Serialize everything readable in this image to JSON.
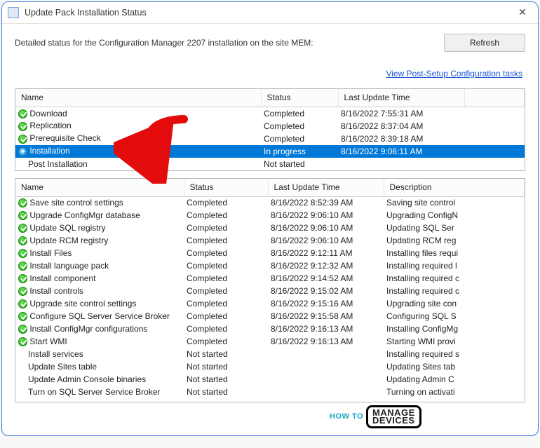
{
  "window": {
    "title": "Update Pack Installation Status",
    "close_glyph": "✕"
  },
  "header": {
    "subtitle": "Detailed status for the Configuration Manager 2207 installation on the site MEM:",
    "refresh_label": "Refresh",
    "link_label": "View Post-Setup Configuration tasks"
  },
  "table1": {
    "columns": {
      "name": "Name",
      "status": "Status",
      "time": "Last Update Time"
    },
    "rows": [
      {
        "icon": "completed",
        "name": "Download",
        "status": "Completed",
        "time": "8/16/2022 7:55:31 AM",
        "selected": false
      },
      {
        "icon": "completed",
        "name": "Replication",
        "status": "Completed",
        "time": "8/16/2022 8:37:04 AM",
        "selected": false
      },
      {
        "icon": "completed",
        "name": "Prerequisite Check",
        "status": "Completed",
        "time": "8/16/2022 8:39:18 AM",
        "selected": false
      },
      {
        "icon": "inprogress",
        "name": "Installation",
        "status": "In progress",
        "time": "8/16/2022 9:06:11 AM",
        "selected": true
      },
      {
        "icon": "",
        "name": "Post Installation",
        "status": "Not started",
        "time": "",
        "selected": false,
        "indent": 1
      }
    ]
  },
  "table2": {
    "columns": {
      "name": "Name",
      "status": "Status",
      "time": "Last Update Time",
      "desc": "Description"
    },
    "rows": [
      {
        "icon": "completed",
        "name": "Save site control settings",
        "status": "Completed",
        "time": "8/16/2022 8:52:39 AM",
        "desc": "Saving site control"
      },
      {
        "icon": "completed",
        "name": "Upgrade ConfigMgr database",
        "status": "Completed",
        "time": "8/16/2022 9:06:10 AM",
        "desc": "Upgrading ConfigN"
      },
      {
        "icon": "completed",
        "name": "Update SQL registry",
        "status": "Completed",
        "time": "8/16/2022 9:06:10 AM",
        "desc": "Updating SQL Ser"
      },
      {
        "icon": "completed",
        "name": "Update RCM registry",
        "status": "Completed",
        "time": "8/16/2022 9:06:10 AM",
        "desc": "Updating RCM reg"
      },
      {
        "icon": "completed",
        "name": "Install Files",
        "status": "Completed",
        "time": "8/16/2022 9:12:11 AM",
        "desc": "Installing files requi"
      },
      {
        "icon": "completed",
        "name": "Install language pack",
        "status": "Completed",
        "time": "8/16/2022 9:12:32 AM",
        "desc": "Installing required l"
      },
      {
        "icon": "completed",
        "name": "Install component",
        "status": "Completed",
        "time": "8/16/2022 9:14:52 AM",
        "desc": "Installing required c"
      },
      {
        "icon": "completed",
        "name": "Install controls",
        "status": "Completed",
        "time": "8/16/2022 9:15:02 AM",
        "desc": "Installing required c"
      },
      {
        "icon": "completed",
        "name": "Upgrade site control settings",
        "status": "Completed",
        "time": "8/16/2022 9:15:16 AM",
        "desc": "Upgrading site con"
      },
      {
        "icon": "completed",
        "name": "Configure SQL Server Service Broker",
        "status": "Completed",
        "time": "8/16/2022 9:15:58 AM",
        "desc": "Configuring SQL S"
      },
      {
        "icon": "completed",
        "name": "Install ConfigMgr configurations",
        "status": "Completed",
        "time": "8/16/2022 9:16:13 AM",
        "desc": "Installing ConfigMg"
      },
      {
        "icon": "completed",
        "name": "Start WMI",
        "status": "Completed",
        "time": "8/16/2022 9:16:13 AM",
        "desc": "Starting WMI provi"
      },
      {
        "icon": "",
        "indent": 1,
        "name": "Install services",
        "status": "Not started",
        "time": "",
        "desc": "Installing required s"
      },
      {
        "icon": "",
        "indent": 1,
        "name": "Update Sites table",
        "status": "Not started",
        "time": "",
        "desc": "Updating Sites tab"
      },
      {
        "icon": "",
        "indent": 1,
        "name": "Update Admin Console binaries",
        "status": "Not started",
        "time": "",
        "desc": "Updating Admin C"
      },
      {
        "icon": "",
        "indent": 1,
        "name": "Turn on SQL Server Service Broker",
        "status": "Not started",
        "time": "",
        "desc": "Turning on activati"
      }
    ]
  },
  "watermark": {
    "howto": "HOW TO",
    "md1": "MANAGE",
    "md2": "DEVICES"
  }
}
